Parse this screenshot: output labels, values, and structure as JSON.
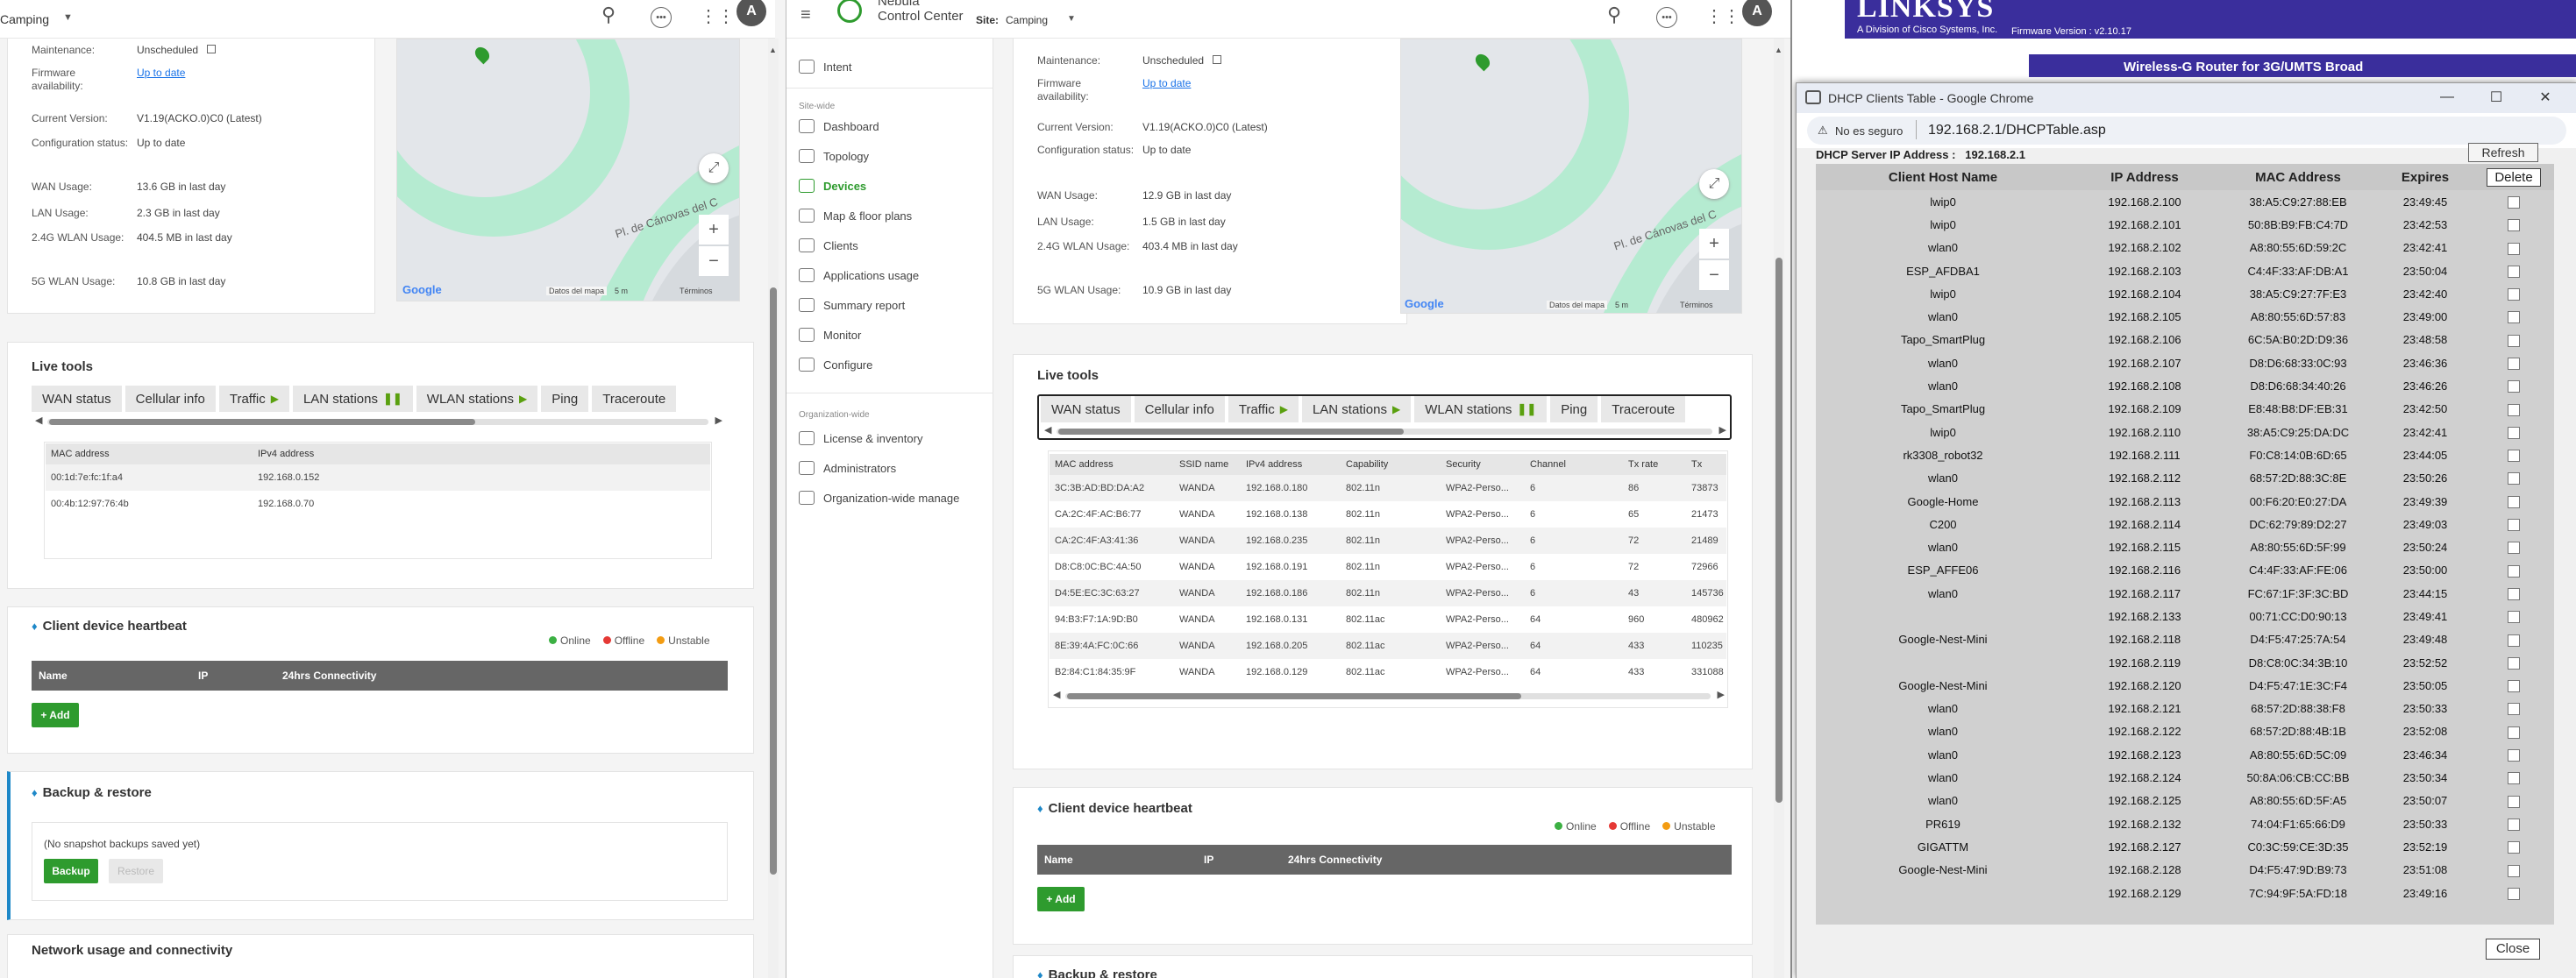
{
  "left": {
    "site_label": "Camping",
    "details": [
      {
        "label": "Maintenance:",
        "value": "Unscheduled"
      },
      {
        "label": "Firmware availability:",
        "value": "Up to date"
      },
      {
        "label": "Current Version:",
        "value": "V1.19(ACKO.0)C0 (Latest)"
      },
      {
        "label": "Configuration status:",
        "value": "Up to date"
      },
      {
        "label": "WAN Usage:",
        "value": "13.6 GB in last day"
      },
      {
        "label": "LAN Usage:",
        "value": "2.3 GB in last day"
      },
      {
        "label": "2.4G WLAN Usage:",
        "value": "404.5 MB in last day"
      },
      {
        "label": "5G WLAN Usage:",
        "value": "10.8 GB in last day"
      }
    ],
    "map": {
      "street": "Pl. de Cánovas del C",
      "google": "Google",
      "attribution": "Datos del mapa",
      "scale": "5 m",
      "terms": "Términos"
    },
    "live_tools_title": "Live tools",
    "tabs": [
      "WAN status",
      "Cellular info",
      "Traffic",
      "LAN stations",
      "WLAN stations",
      "Ping",
      "Traceroute"
    ],
    "lan_table": {
      "headers": [
        "MAC address",
        "IPv4 address"
      ],
      "rows": [
        [
          "00:1d:7e:fc:1f:a4",
          "192.168.0.152"
        ],
        [
          "00:4b:12:97:76:4b",
          "192.168.0.70"
        ]
      ]
    },
    "heartbeat": {
      "title": "Client device heartbeat",
      "legend": [
        "Online",
        "Offline",
        "Unstable"
      ],
      "headers": [
        "Name",
        "IP",
        "24hrs Connectivity"
      ],
      "add": "+ Add"
    },
    "backup": {
      "title": "Backup & restore",
      "empty": "(No snapshot backups saved yet)",
      "backup_btn": "Backup",
      "restore_btn": "Restore"
    },
    "network_title": "Network usage and connectivity"
  },
  "middle": {
    "brand_line1": "Nebula",
    "brand_line2": "Control Center",
    "site_prefix": "Site:",
    "site_label": "Camping",
    "sidebar": {
      "intent": "Intent",
      "section_site": "Site-wide",
      "items": [
        "Dashboard",
        "Topology",
        "Devices",
        "Map & floor plans",
        "Clients",
        "Applications usage",
        "Summary report",
        "Monitor",
        "Configure"
      ],
      "section_org": "Organization-wide",
      "org_items": [
        "License & inventory",
        "Administrators",
        "Organization-wide manage"
      ]
    },
    "details": [
      {
        "label": "Maintenance:",
        "value": "Unscheduled"
      },
      {
        "label": "Firmware availability:",
        "value": "Up to date"
      },
      {
        "label": "Current Version:",
        "value": "V1.19(ACKO.0)C0 (Latest)"
      },
      {
        "label": "Configuration status:",
        "value": "Up to date"
      },
      {
        "label": "WAN Usage:",
        "value": "12.9 GB in last day"
      },
      {
        "label": "LAN Usage:",
        "value": "1.5 GB in last day"
      },
      {
        "label": "2.4G WLAN Usage:",
        "value": "403.4 MB in last day"
      },
      {
        "label": "5G WLAN Usage:",
        "value": "10.9 GB in last day"
      }
    ],
    "map": {
      "street": "Pl. de Cánovas del C",
      "google": "Google",
      "attribution": "Datos del mapa",
      "scale": "5 m",
      "terms": "Términos"
    },
    "live_tools_title": "Live tools",
    "tabs": [
      "WAN status",
      "Cellular info",
      "Traffic",
      "LAN stations",
      "WLAN stations",
      "Ping",
      "Traceroute"
    ],
    "wlan_table": {
      "headers": [
        "MAC address",
        "SSID name",
        "IPv4 address",
        "Capability",
        "Security",
        "Channel",
        "Tx rate",
        "Tx"
      ],
      "rows": [
        [
          "3C:3B:AD:BD:DA:A2",
          "WANDA",
          "192.168.0.180",
          "802.11n",
          "WPA2-Perso...",
          "6",
          "86",
          "73873"
        ],
        [
          "CA:2C:4F:AC:B6:77",
          "WANDA",
          "192.168.0.138",
          "802.11n",
          "WPA2-Perso...",
          "6",
          "65",
          "21473"
        ],
        [
          "CA:2C:4F:A3:41:36",
          "WANDA",
          "192.168.0.235",
          "802.11n",
          "WPA2-Perso...",
          "6",
          "72",
          "21489"
        ],
        [
          "D8:C8:0C:BC:4A:50",
          "WANDA",
          "192.168.0.191",
          "802.11n",
          "WPA2-Perso...",
          "6",
          "72",
          "72966"
        ],
        [
          "D4:5E:EC:3C:63:27",
          "WANDA",
          "192.168.0.186",
          "802.11n",
          "WPA2-Perso...",
          "6",
          "43",
          "145736"
        ],
        [
          "94:B3:F7:1A:9D:B0",
          "WANDA",
          "192.168.0.131",
          "802.11ac",
          "WPA2-Perso...",
          "64",
          "960",
          "480962"
        ],
        [
          "8E:39:4A:FC:0C:66",
          "WANDA",
          "192.168.0.205",
          "802.11ac",
          "WPA2-Perso...",
          "64",
          "433",
          "110235"
        ],
        [
          "B2:84:C1:84:35:9F",
          "WANDA",
          "192.168.0.129",
          "802.11ac",
          "WPA2-Perso...",
          "64",
          "433",
          "331088"
        ]
      ]
    },
    "heartbeat": {
      "title": "Client device heartbeat",
      "legend": [
        "Online",
        "Offline",
        "Unstable"
      ],
      "headers": [
        "Name",
        "IP",
        "24hrs Connectivity"
      ],
      "add": "+ Add"
    },
    "backup_title": "Backup & restore"
  },
  "right": {
    "brand": "LINKSYS",
    "brand_sub": "A Division of Cisco Systems, Inc.",
    "firmware": "Firmware Version : v2.10.17",
    "router_title": "Wireless-G Router for 3G/UMTS Broad",
    "popup_title": "DHCP Clients Table - Google Chrome",
    "not_secure": "No es seguro",
    "url": "192.168.2.1/DHCPTable.asp",
    "server_label": "DHCP Server IP Address :",
    "server_ip": "192.168.2.1",
    "refresh": "Refresh",
    "delete": "Delete",
    "close": "Close",
    "headers": [
      "Client Host Name",
      "IP Address",
      "MAC Address",
      "Expires"
    ],
    "rows": [
      [
        "lwip0",
        "192.168.2.100",
        "38:A5:C9:27:88:EB",
        "23:49:45"
      ],
      [
        "lwip0",
        "192.168.2.101",
        "50:8B:B9:FB:C4:7D",
        "23:42:53"
      ],
      [
        "wlan0",
        "192.168.2.102",
        "A8:80:55:6D:59:2C",
        "23:42:41"
      ],
      [
        "ESP_AFDBA1",
        "192.168.2.103",
        "C4:4F:33:AF:DB:A1",
        "23:50:04"
      ],
      [
        "lwip0",
        "192.168.2.104",
        "38:A5:C9:27:7F:E3",
        "23:42:40"
      ],
      [
        "wlan0",
        "192.168.2.105",
        "A8:80:55:6D:57:83",
        "23:49:00"
      ],
      [
        "Tapo_SmartPlug",
        "192.168.2.106",
        "6C:5A:B0:2D:D9:36",
        "23:48:58"
      ],
      [
        "wlan0",
        "192.168.2.107",
        "D8:D6:68:33:0C:93",
        "23:46:36"
      ],
      [
        "wlan0",
        "192.168.2.108",
        "D8:D6:68:34:40:26",
        "23:46:26"
      ],
      [
        "Tapo_SmartPlug",
        "192.168.2.109",
        "E8:48:B8:DF:EB:31",
        "23:42:50"
      ],
      [
        "lwip0",
        "192.168.2.110",
        "38:A5:C9:25:DA:DC",
        "23:42:41"
      ],
      [
        "rk3308_robot32",
        "192.168.2.111",
        "F0:C8:14:0B:6D:65",
        "23:44:05"
      ],
      [
        "wlan0",
        "192.168.2.112",
        "68:57:2D:88:3C:8E",
        "23:50:26"
      ],
      [
        "Google-Home",
        "192.168.2.113",
        "00:F6:20:E0:27:DA",
        "23:49:39"
      ],
      [
        "C200",
        "192.168.2.114",
        "DC:62:79:89:D2:27",
        "23:49:03"
      ],
      [
        "wlan0",
        "192.168.2.115",
        "A8:80:55:6D:5F:99",
        "23:50:24"
      ],
      [
        "ESP_AFFE06",
        "192.168.2.116",
        "C4:4F:33:AF:FE:06",
        "23:50:00"
      ],
      [
        "wlan0",
        "192.168.2.117",
        "FC:67:1F:3F:3C:BD",
        "23:44:15"
      ],
      [
        "",
        "192.168.2.133",
        "00:71:CC:D0:90:13",
        "23:49:41"
      ],
      [
        "Google-Nest-Mini",
        "192.168.2.118",
        "D4:F5:47:25:7A:54",
        "23:49:48"
      ],
      [
        "",
        "192.168.2.119",
        "D8:C8:0C:34:3B:10",
        "23:52:52"
      ],
      [
        "Google-Nest-Mini",
        "192.168.2.120",
        "D4:F5:47:1E:3C:F4",
        "23:50:05"
      ],
      [
        "wlan0",
        "192.168.2.121",
        "68:57:2D:88:38:F8",
        "23:50:33"
      ],
      [
        "wlan0",
        "192.168.2.122",
        "68:57:2D:88:4B:1B",
        "23:52:08"
      ],
      [
        "wlan0",
        "192.168.2.123",
        "A8:80:55:6D:5C:09",
        "23:46:34"
      ],
      [
        "wlan0",
        "192.168.2.124",
        "50:8A:06:CB:CC:BB",
        "23:50:34"
      ],
      [
        "wlan0",
        "192.168.2.125",
        "A8:80:55:6D:5F:A5",
        "23:50:07"
      ],
      [
        "PR619",
        "192.168.2.132",
        "74:04:F1:65:66:D9",
        "23:50:33"
      ],
      [
        "GIGATTM",
        "192.168.2.127",
        "C0:3C:59:CE:3D:35",
        "23:52:19"
      ],
      [
        "Google-Nest-Mini",
        "192.168.2.128",
        "D4:F5:47:9D:B9:73",
        "23:51:08"
      ],
      [
        "",
        "192.168.2.129",
        "7C:94:9F:5A:FD:18",
        "23:49:16"
      ]
    ]
  },
  "colors": {
    "accent": "#2e9b2e",
    "online": "#3cb043",
    "offline": "#e53935",
    "unstable": "#f39c12",
    "map_green": "#b5ebd1",
    "linksys_blue": "#3a2e9c"
  }
}
